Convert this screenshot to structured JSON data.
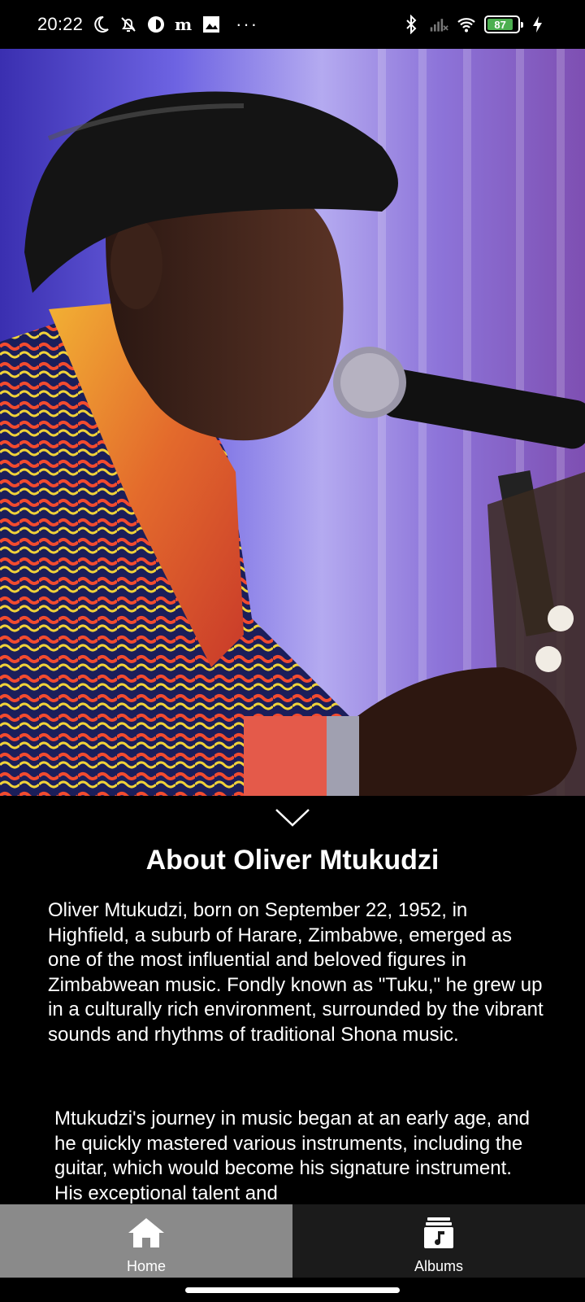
{
  "status_bar": {
    "time": "20:22",
    "left_icons": [
      "moon-icon",
      "bell-off-icon",
      "circle-app-icon",
      "m-app-icon",
      "image-app-icon"
    ],
    "more": "···",
    "right_icons": [
      "bluetooth-icon",
      "signal-icon",
      "wifi-icon"
    ],
    "battery_level": "87",
    "battery_color": "#4caf50"
  },
  "hero": {
    "image_name": "artist-photo"
  },
  "about": {
    "title": "About Oliver Mtukudzi",
    "paragraph_1": "Oliver Mtukudzi, born on September 22, 1952, in Highfield, a suburb of Harare, Zimbabwe, emerged as one of the most influential and beloved figures in Zimbabwean music. Fondly known as \"Tuku,\" he grew up in a culturally rich environment, surrounded by the vibrant sounds and rhythms of traditional Shona music.",
    "paragraph_2": "Mtukudzi's journey in music began at an early age, and he quickly mastered various instruments, including the guitar, which would become his signature instrument. His exceptional talent and"
  },
  "bottom_nav": {
    "items": [
      {
        "label": "Home",
        "icon": "home-icon",
        "active": true
      },
      {
        "label": "Albums",
        "icon": "albums-icon",
        "active": false
      }
    ],
    "active_color": "#8a8a8a",
    "inactive_color": "#1b1b1b"
  }
}
